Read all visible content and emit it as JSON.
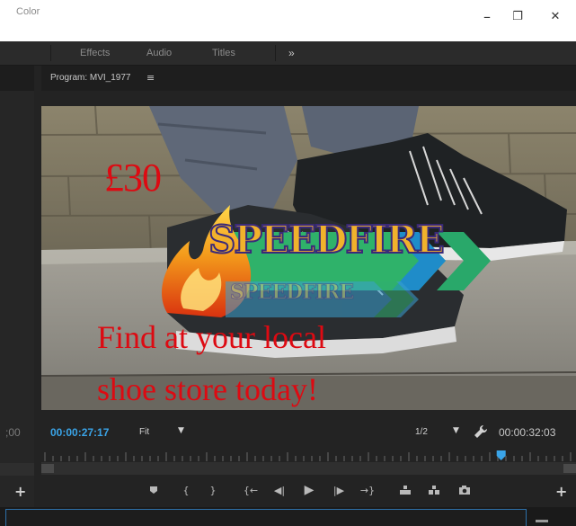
{
  "window": {
    "minimize": "–",
    "restore": "❐",
    "close": "✕"
  },
  "workspace_tabs": [
    "Color",
    "Effects",
    "Audio",
    "Titles"
  ],
  "workspace_more": "»",
  "left_panel": {
    "timecode_fragment": ";00",
    "add": "+"
  },
  "program_monitor": {
    "title": "Program: MVI_1977",
    "menu_glyph": "≡",
    "current_time": "00:00:27:17",
    "zoom": "Fit",
    "resolution": "1/2",
    "duration": "00:00:32:03",
    "playhead_fraction": 0.86,
    "add": "+"
  },
  "video": {
    "price": "£30",
    "logo_text": "SPEEDFIRE",
    "reflection_text": "SPEEDFIRE",
    "tagline_line1": "Find at your local",
    "tagline_line2": "shoe store today!"
  },
  "colors": {
    "timecode_blue": "#3aa4e8",
    "panel_bg": "#232323",
    "headline_red": "#dd0a12"
  }
}
